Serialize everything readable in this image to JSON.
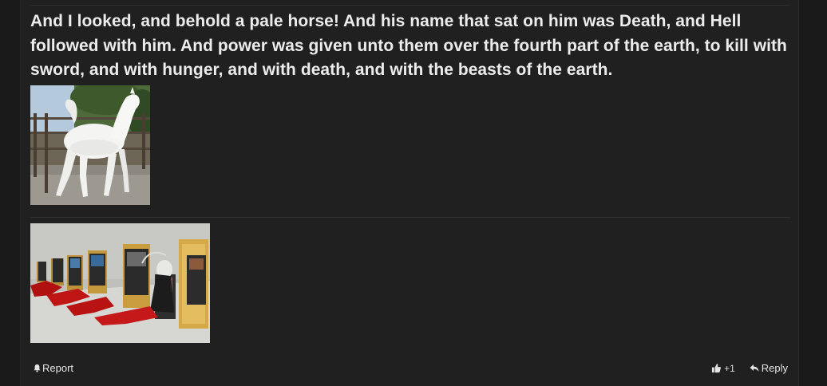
{
  "post": {
    "text": "And I looked, and behold a pale horse! And his name that sat on him was Death, and Hell followed with him. And power was given unto them over the fourth part of the earth, to kill with sword, and with hunger, and with death, and with the beasts of the earth."
  },
  "footer": {
    "report_label": "Report",
    "like_count": "+1",
    "reply_label": "Reply"
  },
  "icons": {
    "report": "bell-icon",
    "like": "thumbs-up-icon",
    "reply": "reply-arrow-icon"
  },
  "colors": {
    "background": "#1a1a1a",
    "panel": "#202020",
    "text": "#ececec"
  }
}
